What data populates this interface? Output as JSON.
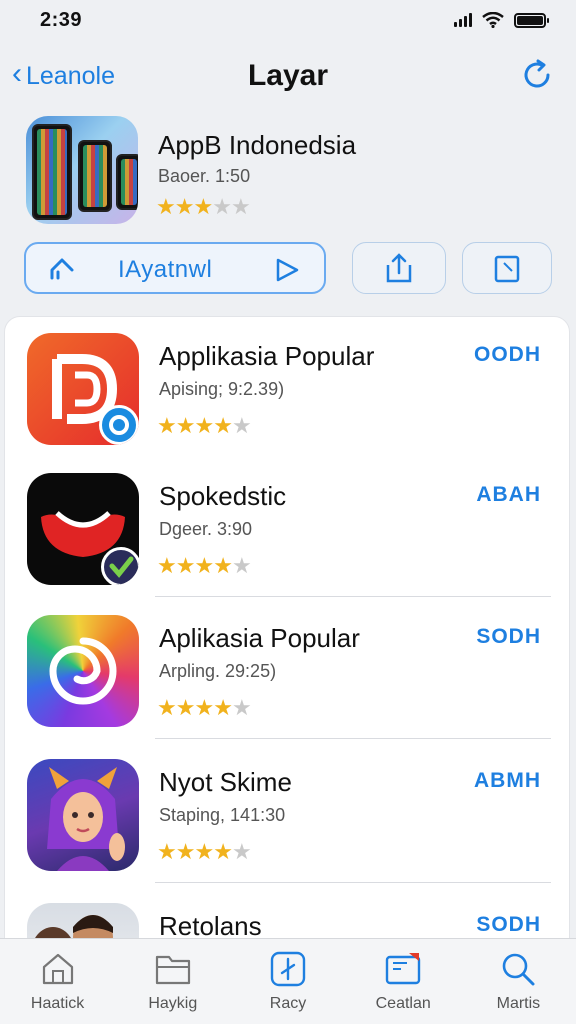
{
  "status_bar": {
    "time": "2:39"
  },
  "nav": {
    "back_label": "Leanole",
    "title": "Layar"
  },
  "featured": {
    "name": "AppВ Indonedsia",
    "subtitle": "Baoer. 1:50",
    "rating": 3
  },
  "actions": {
    "main_label": "ΙAyatnwl"
  },
  "apps": [
    {
      "name": "Applikasia Popular",
      "subtitle": "Apising; 9:2.39)",
      "action": "OODH",
      "rating": 3.5
    },
    {
      "name": "Spokedstic",
      "subtitle": "Dgeer. 3:90",
      "action": "ABAH",
      "rating": 4
    },
    {
      "name": "Aplikasia Popular",
      "subtitle": "Arpling. 29:25)",
      "action": "SODH",
      "rating": 4
    },
    {
      "name": "Nyot Skime",
      "subtitle": "Staping, 141:30",
      "action": "ABMH",
      "rating": 4
    },
    {
      "name": "Retolans",
      "subtitle": "",
      "action": "SODH",
      "rating": 0
    }
  ],
  "tabs": [
    {
      "label": "Haatick",
      "icon": "home-icon"
    },
    {
      "label": "Haykig",
      "icon": "folder-icon"
    },
    {
      "label": "Racy",
      "icon": "compass-icon"
    },
    {
      "label": "Ceatlan",
      "icon": "calendar-icon"
    },
    {
      "label": "Martis",
      "icon": "search-icon"
    }
  ],
  "colors": {
    "accent": "#1e7fe0",
    "star": "#f1b21d",
    "star_off": "#c9c9c9"
  }
}
